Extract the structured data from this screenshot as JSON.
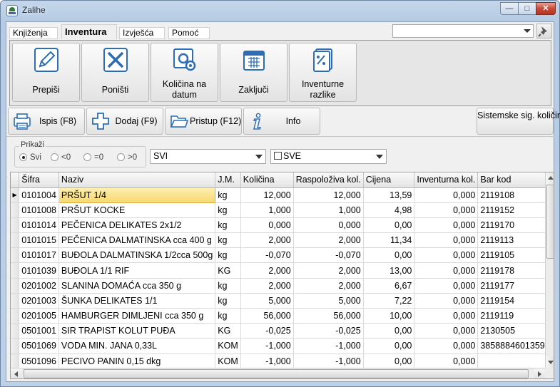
{
  "window": {
    "title": "Zalihe",
    "min": "—",
    "max": "□",
    "close": "✕"
  },
  "menu_tabs": [
    "Knjiženja",
    "Inventura",
    "Izvješća",
    "Pomoć"
  ],
  "active_tab": "Inventura",
  "top_combo": {
    "value": ""
  },
  "ribbon": [
    {
      "icon": "pencil-icon",
      "label": "Prepiši"
    },
    {
      "icon": "cancel-x-icon",
      "label": "Poništi"
    },
    {
      "icon": "refresh-gear-icon",
      "label": "Količina na datum"
    },
    {
      "icon": "calendar-icon",
      "label": "Zaključi"
    },
    {
      "icon": "percent-document-icon",
      "label": "Inventurne razlike"
    }
  ],
  "toolbar": [
    {
      "icon": "printer-icon",
      "label": "Ispis (F8)"
    },
    {
      "icon": "add-plus-icon",
      "label": "Dodaj (F9)"
    },
    {
      "icon": "folder-icon",
      "label": "Pristup (F12)"
    },
    {
      "icon": "info-icon",
      "label": "Info"
    },
    {
      "icon": "",
      "label": "Sistemske sig. količine"
    }
  ],
  "filter": {
    "group_label": "Prikaži",
    "radios": [
      {
        "label": "Svi",
        "checked": true
      },
      {
        "label": "<0",
        "checked": false
      },
      {
        "label": "=0",
        "checked": false
      },
      {
        "label": ">0",
        "checked": false
      }
    ],
    "combo1": "SVI",
    "combo2": "SVE"
  },
  "table": {
    "columns": [
      "Šifra",
      "Naziv",
      "J.M.",
      "Količina",
      "Raspoloživa kol.",
      "Cijena",
      "Inventurna kol.",
      "Bar kod"
    ],
    "selected_row": 0,
    "rows": [
      [
        "0101004",
        "PRŠUT 1/4",
        "kg",
        "12,000",
        "12,000",
        "13,59",
        "0,000",
        "2119108"
      ],
      [
        "0101008",
        "PRŠUT KOCKE",
        "kg",
        "1,000",
        "1,000",
        "4,98",
        "0,000",
        "2119152"
      ],
      [
        "0101014",
        "PEČENICA DELIKATES 2x1/2",
        "kg",
        "0,000",
        "0,000",
        "0,00",
        "0,000",
        "2119170"
      ],
      [
        "0101015",
        "PEČENICA DALMATINSKA cca 400 g",
        "kg",
        "2,000",
        "2,000",
        "11,34",
        "0,000",
        "2119113"
      ],
      [
        "0101017",
        "BUĐOLA DALMATINSKA 1/2cca 500g",
        "kg",
        "-0,070",
        "-0,070",
        "0,00",
        "0,000",
        "2119105"
      ],
      [
        "0101039",
        "BUĐOLA 1/1 RIF",
        "KG",
        "2,000",
        "2,000",
        "13,00",
        "0,000",
        "2119178"
      ],
      [
        "0201002",
        "SLANINA DOMAĆA cca 350 g",
        "kg",
        "2,000",
        "2,000",
        "6,67",
        "0,000",
        "2119177"
      ],
      [
        "0201003",
        "ŠUNKA DELIKATES 1/1",
        "kg",
        "5,000",
        "5,000",
        "7,22",
        "0,000",
        "2119154"
      ],
      [
        "0201005",
        "HAMBURGER DIMLJENI cca 350 g",
        "kg",
        "56,000",
        "56,000",
        "10,00",
        "0,000",
        "2119119"
      ],
      [
        "0501001",
        "SIR TRAPIST KOLUT PUĐA",
        "KG",
        "-0,025",
        "-0,025",
        "0,00",
        "0,000",
        "2130505"
      ],
      [
        "0501069",
        "VODA MIN. JANA 0,33L",
        "KOM",
        "-1,000",
        "-1,000",
        "0,00",
        "0,000",
        "3858884601359"
      ],
      [
        "0501096",
        "PECIVO PANIN 0,15 dkg",
        "KOM",
        "-1,000",
        "-1,000",
        "0,00",
        "0,000",
        ""
      ]
    ]
  }
}
